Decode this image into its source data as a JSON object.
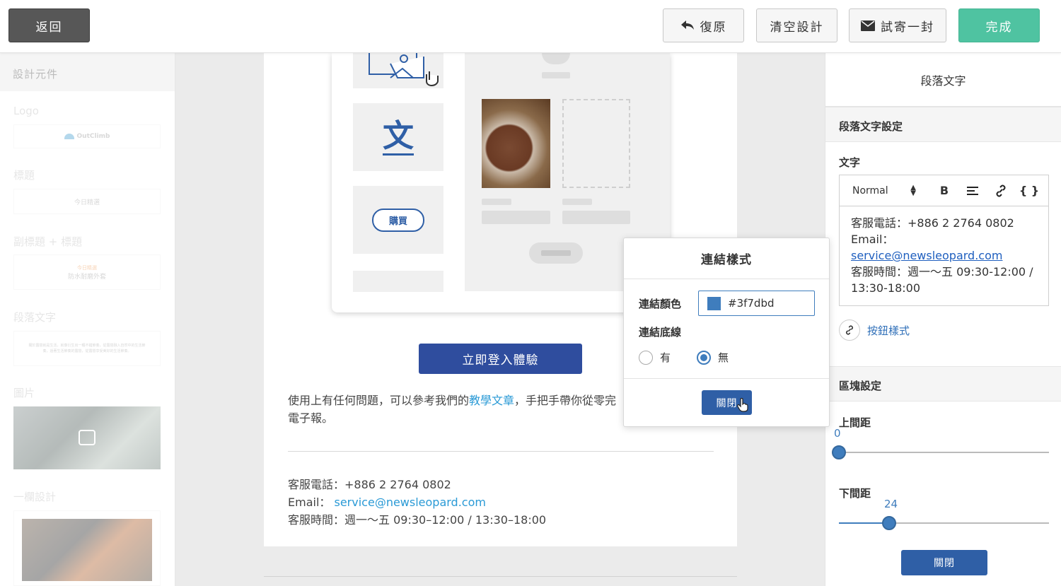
{
  "topbar": {
    "back_label": "返回",
    "undo_label": "復原",
    "clear_label": "清空設計",
    "test_send_label": "試寄一封",
    "done_label": "完成"
  },
  "left_panel": {
    "header": "設計元件",
    "sections": {
      "logo": "Logo",
      "logo_text": "OutClimb",
      "title": "標題",
      "title_preview": "今日精選",
      "subtitle_title": "副標題 + 標題",
      "subtitle_preview_top": "今日精選",
      "subtitle_preview": "防水耐磨外套",
      "paragraph": "段落文字",
      "paragraph_preview": "關於露營就是生活，就像衍生出一種不錯節奏，從露營融入自然中的生活節奏，過著生活節奏的露營，從露營享受美好的生活節奏。",
      "image": "圖片",
      "one_column": "一欄設計"
    }
  },
  "canvas": {
    "mock_text_glyph": "文",
    "mock_buy_label": "購買",
    "cta_label": "立即登入體驗",
    "help_text_1": "使用上有任何問題，可以參考我們的",
    "help_link": "教學文章",
    "help_text_2": "，手把手帶你從零完",
    "help_text_3": "電子報。",
    "phone_line": "客服電話：+886 2 2764 0802",
    "email_prefix": "Email：",
    "email_link": "service@newsleopard.com",
    "hours_line": "客服時間：週一～五 09:30–12:00 / 13:30–18:00"
  },
  "link_style_popup": {
    "title": "連結樣式",
    "color_label": "連結顏色",
    "color_value": "#3f7dbd",
    "underline_label": "連結底線",
    "option_yes": "有",
    "option_no": "無",
    "selected_option": "無",
    "close_label": "關閉"
  },
  "right_panel": {
    "title": "段落文字",
    "settings_header": "段落文字設定",
    "text_label": "文字",
    "format_select": "Normal",
    "toolbar_bold": "B",
    "toolbar_code": "{ }",
    "editor_phone": "客服電話：+886 2 2764 0802",
    "editor_email_prefix": "Email：",
    "editor_email_link": "service@newsleopard.com",
    "editor_hours": "客服時間：週一～五 09:30-12:00 /",
    "editor_hours_2": "13:30-18:00",
    "button_style_label": "按鈕樣式",
    "block_settings_header": "區塊設定",
    "top_padding_label": "上間距",
    "top_padding_value": "0",
    "bottom_padding_label": "下間距",
    "bottom_padding_value": "24",
    "close_label": "關閉"
  },
  "colors": {
    "accent": "#3f7dbd",
    "done_green": "#4fc3a1",
    "cta_blue": "#2f4d9e",
    "link_blue": "#2a9ad6"
  }
}
